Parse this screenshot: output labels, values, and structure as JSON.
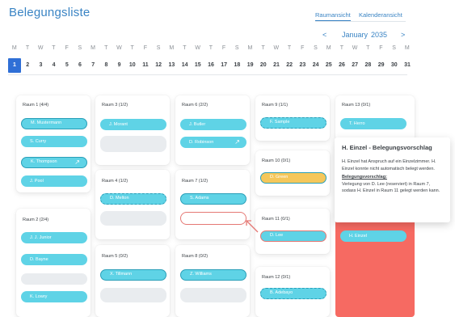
{
  "header": {
    "title": "Belegungsliste"
  },
  "view_tabs": [
    {
      "label": "Raumansicht",
      "active": true
    },
    {
      "label": "Kalenderansicht",
      "active": false
    }
  ],
  "month_nav": {
    "prev": "<",
    "month": "January",
    "year": "2035",
    "next": ">"
  },
  "weekdays": [
    "M",
    "T",
    "W",
    "T",
    "F",
    "S",
    "M",
    "T",
    "W",
    "T",
    "F",
    "S",
    "M",
    "T",
    "W",
    "T",
    "F",
    "S",
    "M",
    "T",
    "W",
    "T",
    "F",
    "S",
    "M",
    "T",
    "W",
    "T",
    "F",
    "S",
    "M"
  ],
  "days": [
    "1",
    "2",
    "3",
    "4",
    "5",
    "6",
    "7",
    "8",
    "9",
    "10",
    "11",
    "12",
    "13",
    "14",
    "15",
    "16",
    "17",
    "18",
    "19",
    "20",
    "21",
    "22",
    "23",
    "24",
    "25",
    "26",
    "27",
    "28",
    "29",
    "30",
    "31"
  ],
  "selected_day": "1",
  "rooms": {
    "r1": {
      "label": "Raum 1 (4/4)",
      "guests": [
        "M. Mustermann",
        "S. Curry",
        "K. Thompson",
        "J. Pool"
      ]
    },
    "r2": {
      "label": "Raum 2 (2/4)",
      "guests": [
        "J. J. Junior",
        "D. Bayne",
        "K. Lowry"
      ]
    },
    "r3": {
      "label": "Raum 3 (1/2)",
      "guests": [
        "J. Morant"
      ]
    },
    "r4": {
      "label": "Raum 4 (1/2)",
      "guests": [
        "D. Melton"
      ]
    },
    "r5": {
      "label": "Raum 5 (0/2)",
      "guests": [
        "X. Tillmann"
      ]
    },
    "r6": {
      "label": "Raum 6 (2/2)",
      "guests": [
        "J. Butler",
        "D. Robinson"
      ]
    },
    "r7": {
      "label": "Raum 7 (1/2)",
      "guests": [
        "S. Adams"
      ]
    },
    "r8": {
      "label": "Raum 8 (0/2)",
      "guests": [
        "Z. Williams"
      ]
    },
    "r9": {
      "label": "Raum 9 (1/1)",
      "guests": [
        "F. Sample"
      ]
    },
    "r10": {
      "label": "Raum 10 (0/1)",
      "guests": [
        "D. Green"
      ]
    },
    "r11": {
      "label": "Raum 11 (0/1)",
      "guests": [
        "D. Lee"
      ]
    },
    "r12": {
      "label": "Raum 12 (0/1)",
      "guests": [
        "B. Adebayo"
      ]
    },
    "r13": {
      "label": "Raum 13 (0/1)",
      "guests": [
        "T. Herro",
        "H. Einzel"
      ]
    }
  },
  "tooltip": {
    "title": "H. Einzel - Belegungsvorschlag",
    "text": "H. Einzel hat Anspruch auf ein Einzelzimmer. H. Einzel konnte nicht automatisch belegt werden.",
    "subtitle": "Belegungsvorschlag:",
    "suggestion": "Verlegung von D. Lee (reserviert) in Raum 7, sodass H. Einzel in Raum 11 gelegt werden kann."
  },
  "colors": {
    "accent": "#3a84c4",
    "pill": "#5fd3e6",
    "pill_border": "#2a9fb8",
    "warning": "#f66a62",
    "reserved": "#f5c75a",
    "selected_day": "#2f6fd6"
  }
}
